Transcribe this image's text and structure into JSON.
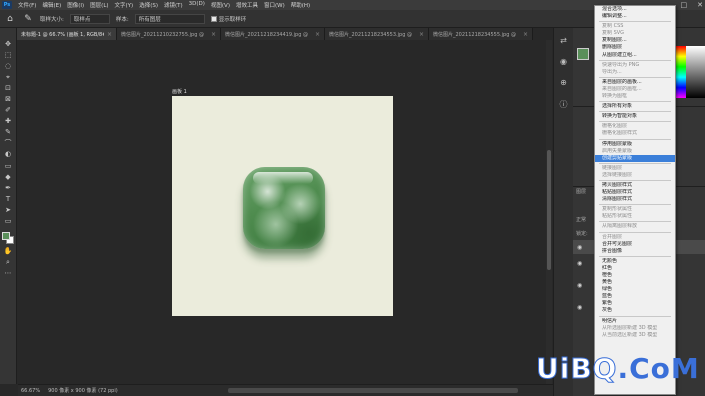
{
  "menubar": {
    "logo": "Ps",
    "items": [
      "文件(F)",
      "编辑(E)",
      "图像(I)",
      "图层(L)",
      "文字(Y)",
      "选择(S)",
      "滤镜(T)",
      "3D(D)",
      "视图(V)",
      "增效工具",
      "窗口(W)",
      "帮助(H)"
    ],
    "win_min": "—",
    "win_max": "□",
    "win_close": "✕"
  },
  "options": {
    "home_icon": "⌂",
    "eyedropper_icon": "✎",
    "sample_size_label": "取样大小:",
    "sample_size_value": "取样点",
    "sample_label": "样本:",
    "sample_value": "所有图层",
    "show_ring_label": "显示取样环"
  },
  "tabs": [
    {
      "label": "未标题-1 @ 66.7% (画板 1, RGB/8#) *",
      "active": true
    },
    {
      "label": "微信图片_20211210232755.jpg @",
      "active": false
    },
    {
      "label": "微信图片_20211218234419.jpg @",
      "active": false
    },
    {
      "label": "微信图片_20211218234553.jpg @",
      "active": false
    },
    {
      "label": "微信图片_20211218234555.jpg @",
      "active": false
    }
  ],
  "tools": [
    "✥",
    "⬚",
    "◌",
    "⌖",
    "⊡",
    "⊠",
    "✐",
    "✚",
    "✎",
    "⌒",
    "◐",
    "▭",
    "◆",
    "✒",
    "T",
    "➤",
    "▭",
    "✋",
    "⌕",
    "⋯"
  ],
  "artboard": {
    "label": "画板 1"
  },
  "status": {
    "zoom": "66.67%",
    "size": "900 像素 x 900 像素 (72 ppi)"
  },
  "strip_icons": [
    "⇄",
    "◉",
    "⊕",
    "ⓘ"
  ],
  "context_menu": [
    {
      "label": "混合选项...",
      "state": "enabled"
    },
    {
      "label": "编辑调整...",
      "state": "enabled"
    },
    {
      "sep": true
    },
    {
      "label": "复制 CSS",
      "state": "disabled"
    },
    {
      "label": "复制 SVG",
      "state": "disabled"
    },
    {
      "label": "复制图层...",
      "state": "enabled"
    },
    {
      "label": "删除图层",
      "state": "enabled"
    },
    {
      "label": "从图层建立组...",
      "state": "enabled"
    },
    {
      "sep": true
    },
    {
      "label": "快速导出为 PNG",
      "state": "disabled"
    },
    {
      "label": "导出为...",
      "state": "disabled"
    },
    {
      "sep": true
    },
    {
      "label": "来自图层的画板...",
      "state": "enabled"
    },
    {
      "label": "来自图层的画框...",
      "state": "disabled"
    },
    {
      "label": "转换为图框",
      "state": "disabled"
    },
    {
      "sep": true
    },
    {
      "label": "选择所有对象",
      "state": "enabled"
    },
    {
      "sep": true
    },
    {
      "label": "转换为智能对象",
      "state": "enabled"
    },
    {
      "sep": true
    },
    {
      "label": "栅格化图层",
      "state": "disabled"
    },
    {
      "label": "栅格化图层样式",
      "state": "disabled"
    },
    {
      "sep": true
    },
    {
      "label": "停用图层蒙版",
      "state": "enabled"
    },
    {
      "label": "启用矢量蒙版",
      "state": "disabled"
    },
    {
      "label": "创建剪贴蒙版",
      "state": "highlighted"
    },
    {
      "sep": true
    },
    {
      "label": "链接图层",
      "state": "disabled"
    },
    {
      "label": "选择链接图层",
      "state": "disabled"
    },
    {
      "sep": true
    },
    {
      "label": "拷贝图层样式",
      "state": "enabled"
    },
    {
      "label": "粘贴图层样式",
      "state": "enabled"
    },
    {
      "label": "清除图层样式",
      "state": "enabled"
    },
    {
      "sep": true
    },
    {
      "label": "复制形状属性",
      "state": "disabled"
    },
    {
      "label": "粘贴形状属性",
      "state": "disabled"
    },
    {
      "sep": true
    },
    {
      "label": "从隔离图层释放",
      "state": "disabled"
    },
    {
      "sep": true
    },
    {
      "label": "合并图层",
      "state": "disabled"
    },
    {
      "label": "合并可见图层",
      "state": "enabled"
    },
    {
      "label": "拼合图像",
      "state": "enabled"
    },
    {
      "sep": true
    },
    {
      "label": "无颜色",
      "state": "enabled"
    },
    {
      "label": "红色",
      "state": "enabled"
    },
    {
      "label": "橙色",
      "state": "enabled"
    },
    {
      "label": "黄色",
      "state": "enabled"
    },
    {
      "label": "绿色",
      "state": "enabled"
    },
    {
      "label": "蓝色",
      "state": "enabled"
    },
    {
      "label": "紫色",
      "state": "enabled"
    },
    {
      "label": "灰色",
      "state": "enabled"
    },
    {
      "sep": true
    },
    {
      "label": "明信片",
      "state": "enabled"
    },
    {
      "label": "从所选图层新建 3D 模型",
      "state": "disabled"
    },
    {
      "label": "从当前选区新建 3D 模型",
      "state": "disabled"
    }
  ],
  "layers": {
    "tab_1": "图层",
    "tab_2": "正常",
    "tab_3": "锁定:"
  },
  "watermark": {
    "part_a": "UiBQ",
    "part_b": ".CoM"
  },
  "colors": {
    "accent": "#3b7fd9",
    "jade": "#4f8c4f",
    "artboard": "#ebecdc"
  }
}
